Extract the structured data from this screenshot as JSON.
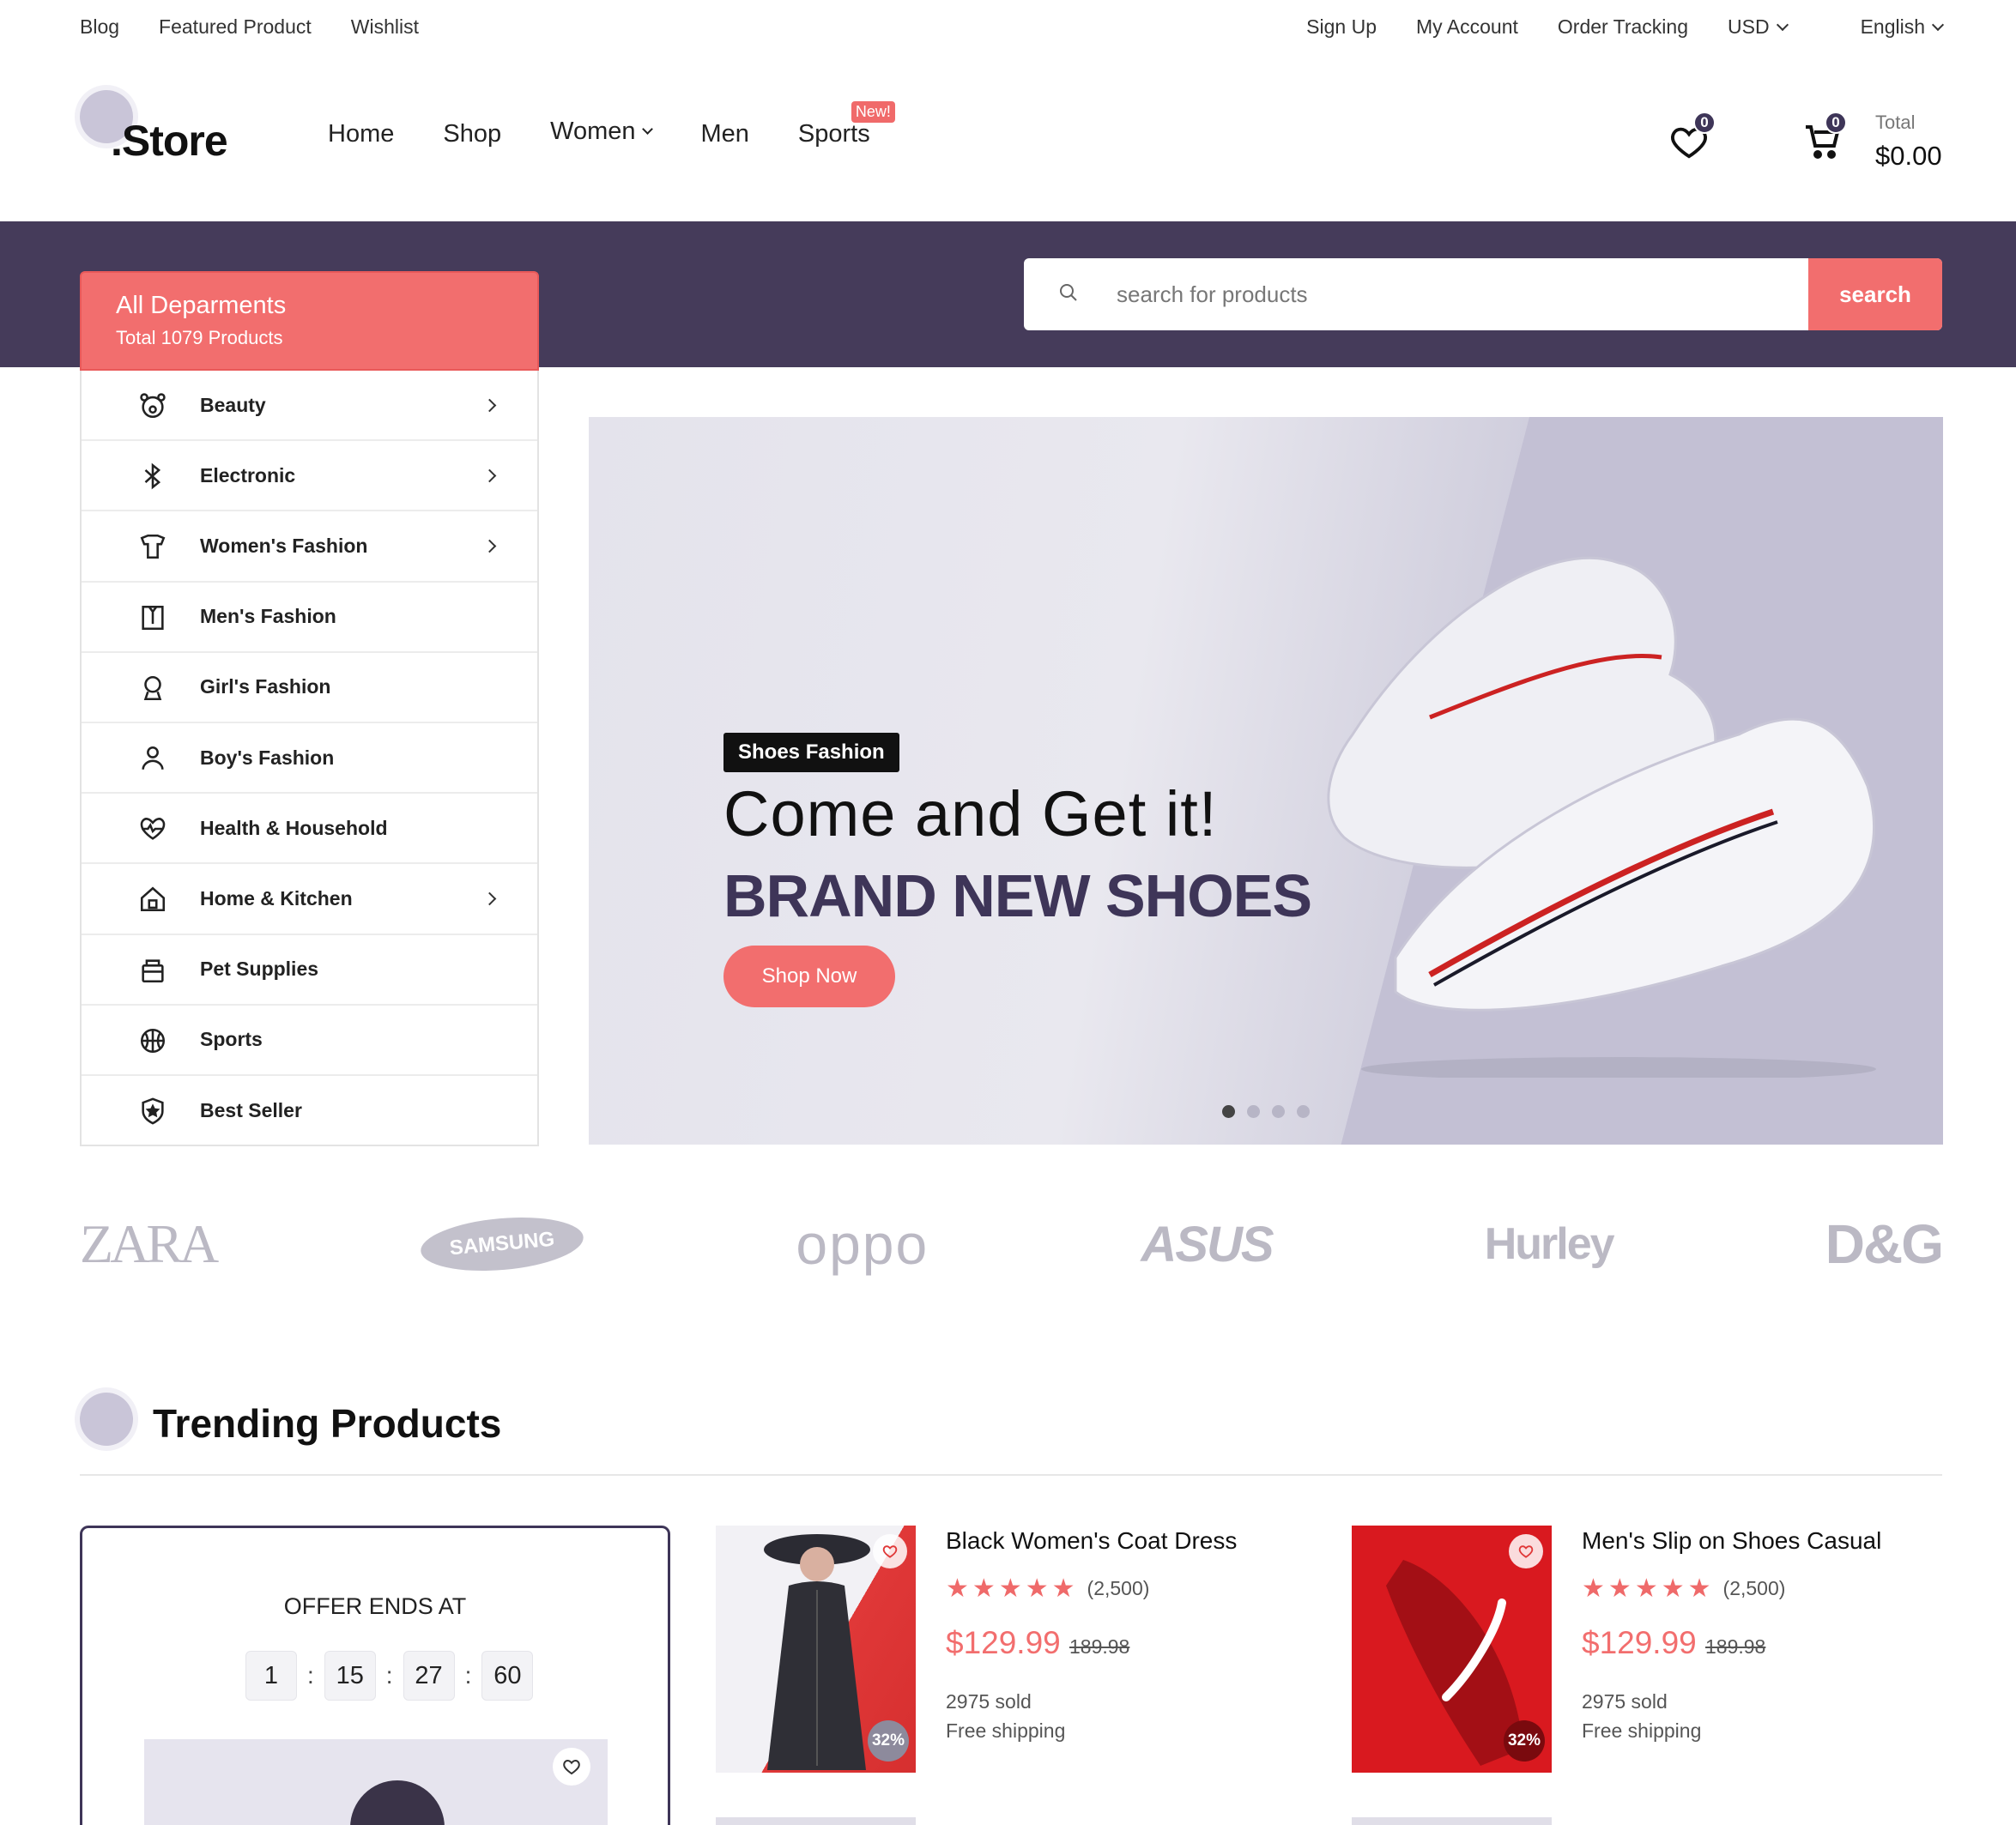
{
  "topbar": {
    "left_links": [
      "Blog",
      "Featured Product",
      "Wishlist"
    ],
    "right_links": [
      "Sign Up",
      "My Account",
      "Order Tracking"
    ],
    "currency": "USD",
    "language": "English"
  },
  "header": {
    "logo_text": ".Store",
    "nav": [
      "Home",
      "Shop",
      "Women",
      "Men",
      "Sports"
    ],
    "new_badge": "New!",
    "wishlist_count": "0",
    "cart_count": "0",
    "total_label": "Total",
    "total_value": "$0.00"
  },
  "departments": {
    "title": "All Deparments",
    "subtitle": "Total 1079 Products",
    "items": [
      {
        "label": "Beauty",
        "icon": "bear-face-icon",
        "arrow": true
      },
      {
        "label": "Electronic",
        "icon": "bluetooth-icon",
        "arrow": true
      },
      {
        "label": "Women's Fashion",
        "icon": "tshirt-icon",
        "arrow": true
      },
      {
        "label": "Men's Fashion",
        "icon": "shirt-tie-icon",
        "arrow": false
      },
      {
        "label": "Girl's Fashion",
        "icon": "girl-icon",
        "arrow": false
      },
      {
        "label": "Boy's Fashion",
        "icon": "boy-icon",
        "arrow": false
      },
      {
        "label": "Health & Household",
        "icon": "heartbeat-icon",
        "arrow": false
      },
      {
        "label": "Home & Kitchen",
        "icon": "home-icon",
        "arrow": true
      },
      {
        "label": "Pet Supplies",
        "icon": "pet-box-icon",
        "arrow": false
      },
      {
        "label": "Sports",
        "icon": "basketball-icon",
        "arrow": false
      },
      {
        "label": "Best Seller",
        "icon": "shield-star-icon",
        "arrow": false
      }
    ]
  },
  "search": {
    "placeholder": "search for products",
    "button": "search"
  },
  "hero": {
    "tag": "Shoes Fashion",
    "headline": "Come and Get it!",
    "subheadline": "BRAND NEW SHOES",
    "cta": "Shop Now",
    "slides": 4,
    "active_slide": 1
  },
  "brands": [
    "ZARA",
    "SAMSUNG",
    "oppo",
    "ASUS",
    "Hurley",
    "D&G"
  ],
  "trending": {
    "title": "Trending Products",
    "offer": {
      "heading": "OFFER ENDS AT",
      "countdown": [
        "1",
        "15",
        "27",
        "60"
      ]
    },
    "products": [
      {
        "name": "Black Women's Coat Dress",
        "reviews": "(2,500)",
        "price": "$129.99",
        "old_price": "189.98",
        "sold": "2975 sold",
        "shipping": "Free shipping",
        "discount": "32%",
        "rating": 5
      },
      {
        "name": "Men's Slip on Shoes Casual",
        "reviews": "(2,500)",
        "price": "$129.99",
        "old_price": "189.98",
        "sold": "2975 sold",
        "shipping": "Free shipping",
        "discount": "32%",
        "rating": 5
      }
    ]
  },
  "colors": {
    "accent": "#f26e6e",
    "brand_dark": "#453b5a"
  }
}
